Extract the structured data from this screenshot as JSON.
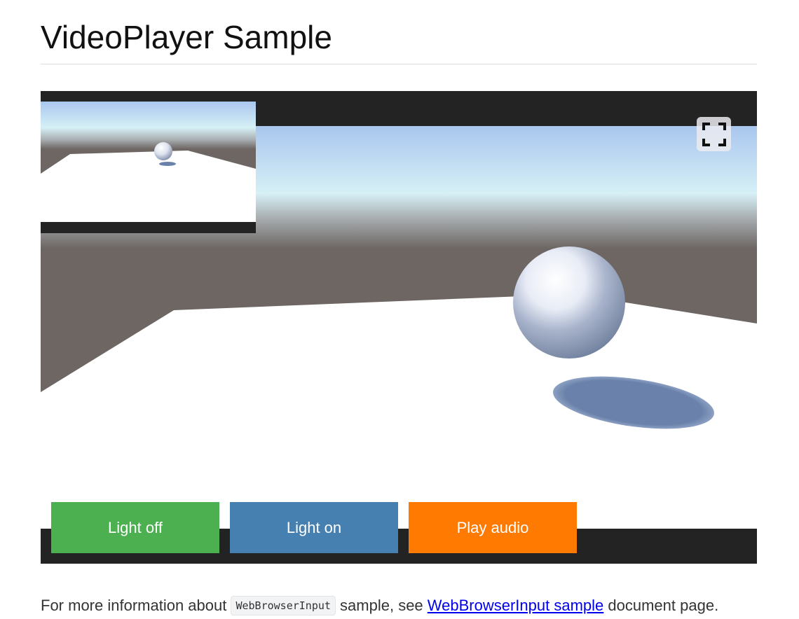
{
  "page": {
    "title": "VideoPlayer Sample"
  },
  "player": {
    "fullscreen_icon": "fullscreen-icon",
    "buttons": [
      {
        "label": "Light off",
        "color": "#4caf50"
      },
      {
        "label": "Light on",
        "color": "#4680b0"
      },
      {
        "label": "Play audio",
        "color": "#ff7a00"
      }
    ]
  },
  "info": {
    "prefix": "For more information about ",
    "code": "WebBrowserInput",
    "middle": " sample, see ",
    "link_text": "WebBrowserInput sample",
    "suffix": " document page."
  }
}
